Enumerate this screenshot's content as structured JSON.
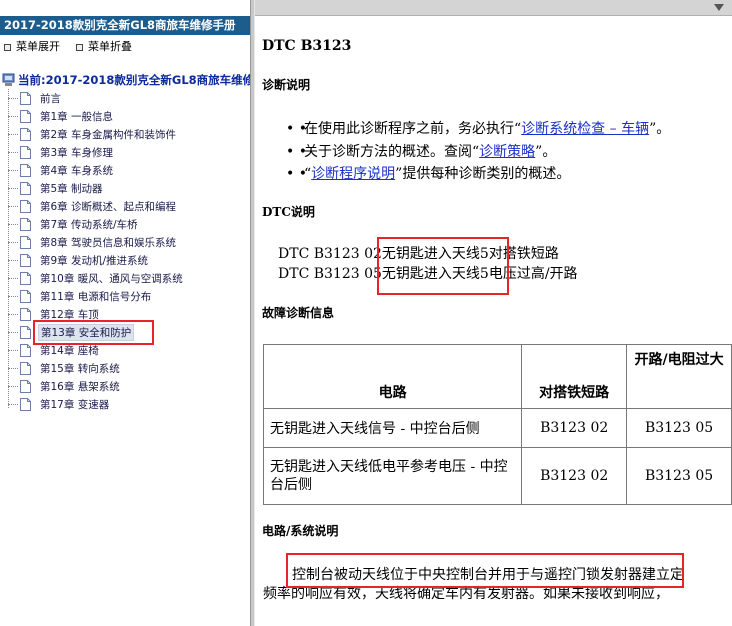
{
  "left_pane": {
    "manual_title": "2017-2018款别克全新GL8商旅车维修手册",
    "menu_expand": "菜单展开",
    "menu_collapse": "菜单折叠",
    "tree_root": "当前:2017-2018款别克全新GL8商旅车维修",
    "tree_items": [
      "前言",
      "第1章 一般信息",
      "第2章 车身金属构件和装饰件",
      "第3章 车身修理",
      "第4章 车身系统",
      "第5章 制动器",
      "第6章 诊断概述、起点和编程",
      "第7章 传动系统/车桥",
      "第8章 驾驶员信息和娱乐系统",
      "第9章 发动机/推进系统",
      "第10章 暖风、通风与空调系统",
      "第11章 电源和信号分布",
      "第12章 车顶",
      "第13章 安全和防护",
      "第14章 座椅",
      "第15章 转向系统",
      "第16章 悬架系统",
      "第17章 变速器"
    ],
    "selected_index": 13
  },
  "content": {
    "heading": "DTC B3123",
    "diag_title": "诊断说明",
    "bullets": [
      {
        "before": "在使用此诊断程序之前，务必执行“",
        "link": "诊断系统检查 – 车辆",
        "after": "”。"
      },
      {
        "before": "关于诊断方法的概述。查阅“",
        "link": "诊断策略",
        "after": "”。"
      },
      {
        "before": "“",
        "link": "诊断程序说明",
        "after": "”提供每种诊断类别的概述。"
      }
    ],
    "dtc_title": "DTC说明",
    "dtc_lines": [
      {
        "code": "DTC B3123 02",
        "desc": "无钥匙进入天线5对搭铁短路"
      },
      {
        "code": "DTC B3123 05",
        "desc": "无钥匙进入天线5电压过高/开路"
      }
    ],
    "fault_title": "故障诊断信息",
    "table": {
      "headers": [
        "电路",
        "对搭铁短路",
        "开路/电阻过大"
      ],
      "rows": [
        [
          "无钥匙进入天线信号 - 中控台后侧",
          "B3123 02",
          "B3123 05"
        ],
        [
          "无钥匙进入天线低电平参考电压 - 中控台后侧",
          "B3123 02",
          "B3123 05"
        ]
      ]
    },
    "circuit_title": "电路/系统说明",
    "para_line1": "控制台被动天线位于中央控制台并用于与遥控门锁发射器建立定",
    "para_line2": "频率的响应有效，天线将确定车内有发射器。如果未接收到响应，"
  },
  "colors": {
    "title_bar": "#1c5d8e",
    "highlight_box": "#e8232a",
    "link": "#1a31c7",
    "tree_root": "#0b2a9e"
  }
}
